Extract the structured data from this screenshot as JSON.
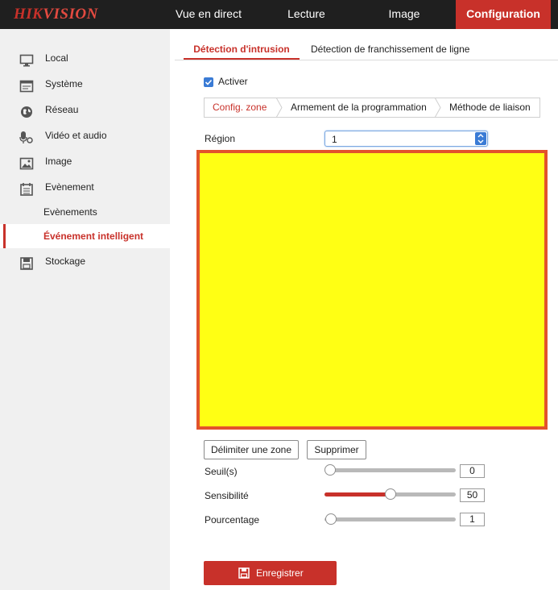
{
  "brand": {
    "logo_a": "HIK",
    "logo_b": "VISION"
  },
  "top_nav": [
    {
      "label": "Vue en direct"
    },
    {
      "label": "Lecture"
    },
    {
      "label": "Image"
    },
    {
      "label": "Configuration",
      "active": true
    }
  ],
  "sidebar": {
    "items": [
      {
        "label": "Local",
        "icon": "monitor-icon"
      },
      {
        "label": "Système",
        "icon": "system-icon"
      },
      {
        "label": "Réseau",
        "icon": "globe-icon"
      },
      {
        "label": "Vidéo et audio",
        "icon": "microphone-icon"
      },
      {
        "label": "Image",
        "icon": "picture-icon"
      },
      {
        "label": "Evènement",
        "icon": "calendar-icon"
      }
    ],
    "subitems": [
      {
        "label": "Evènements"
      },
      {
        "label": "Événement intelligent",
        "active": true
      }
    ],
    "storage": {
      "label": "Stockage",
      "icon": "save-disk-icon"
    }
  },
  "main": {
    "tabs": [
      {
        "label": "Détection d'intrusion",
        "active": true
      },
      {
        "label": "Détection de franchissement de ligne"
      }
    ],
    "enable": {
      "label": "Activer",
      "checked": true
    },
    "subtabs": [
      {
        "label": "Config. zone",
        "active": true
      },
      {
        "label": "Armement de la programmation"
      },
      {
        "label": "Méthode de liaison"
      }
    ],
    "region": {
      "label": "Région",
      "value": "1"
    },
    "buttons": {
      "draw": "Délimiter une zone",
      "delete": "Supprimer"
    },
    "sliders": [
      {
        "label": "Seuil(s)",
        "value": 0,
        "max": 100,
        "display": "0"
      },
      {
        "label": "Sensibilité",
        "value": 50,
        "max": 100,
        "display": "50"
      },
      {
        "label": "Pourcentage",
        "value": 1,
        "max": 100,
        "display": "1"
      }
    ],
    "save_label": "Enregistrer"
  },
  "colors": {
    "accent": "#c8312a",
    "canvas_fill": "#ffff14",
    "canvas_border": "#e2532c",
    "checkbox": "#3a7bd5"
  }
}
